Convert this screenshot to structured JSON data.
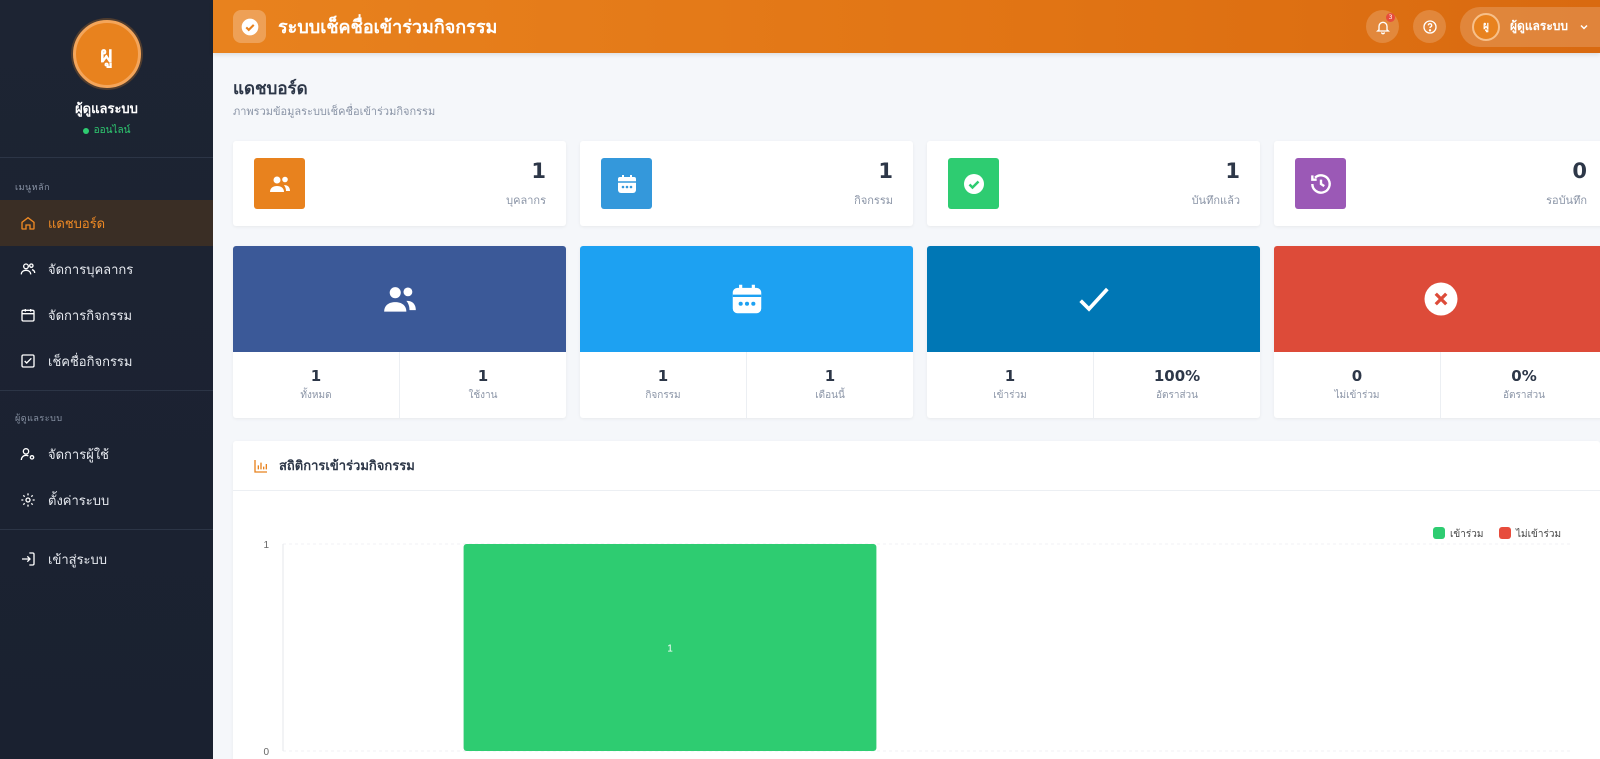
{
  "sidebar": {
    "avatar_initials": "ผู",
    "user_name": "ผู้ดูแลระบบ",
    "status": "ออนไลน์",
    "section_main": "เมนูหลัก",
    "section_admin": "ผู้ดูแลระบบ",
    "items": [
      {
        "label": "แดชบอร์ด",
        "icon": "home-icon",
        "active": true
      },
      {
        "label": "จัดการบุคลากร",
        "icon": "users-icon"
      },
      {
        "label": "จัดการกิจกรรม",
        "icon": "calendar-icon"
      },
      {
        "label": "เช็คชื่อกิจกรรม",
        "icon": "checkbox-icon"
      }
    ],
    "admin_items": [
      {
        "label": "จัดการผู้ใช้",
        "icon": "user-cog-icon"
      },
      {
        "label": "ตั้งค่าระบบ",
        "icon": "gear-icon"
      }
    ],
    "login_label": "เข้าสู่ระบบ"
  },
  "header": {
    "title": "ระบบเช็คชื่อเข้าร่วมกิจกรรม",
    "notification_count": "3",
    "user_initials": "ผู",
    "user_name": "ผู้ดูแลระบบ"
  },
  "page": {
    "title": "แดชบอร์ด",
    "subtitle": "ภาพรวมข้อมูลระบบเช็คชื่อเข้าร่วมกิจกรรม"
  },
  "stats": [
    {
      "value": "1",
      "label": "บุคลากร",
      "color": "#e8821e",
      "icon": "users-icon"
    },
    {
      "value": "1",
      "label": "กิจกรรม",
      "color": "#3498db",
      "icon": "calendar-icon"
    },
    {
      "value": "1",
      "label": "บันทึกแล้ว",
      "color": "#2ecc71",
      "icon": "check-circle-icon"
    },
    {
      "value": "0",
      "label": "รอบันทึก",
      "color": "#9b59b6",
      "icon": "history-icon"
    }
  ],
  "big_cards": [
    {
      "color": "#3b5998",
      "icon": "users-icon",
      "left_value": "1",
      "left_label": "ทั้งหมด",
      "right_value": "1",
      "right_label": "ใช้งาน"
    },
    {
      "color": "#1da1f2",
      "icon": "calendar-icon",
      "left_value": "1",
      "left_label": "กิจกรรม",
      "right_value": "1",
      "right_label": "เดือนนี้"
    },
    {
      "color": "#0077b5",
      "icon": "check-icon",
      "left_value": "1",
      "left_label": "เข้าร่วม",
      "right_value": "100%",
      "right_label": "อัตราส่วน"
    },
    {
      "color": "#dd4b39",
      "icon": "x-circle-icon",
      "left_value": "0",
      "left_label": "ไม่เข้าร่วม",
      "right_value": "0%",
      "right_label": "อัตราส่วน"
    }
  ],
  "chart_section": {
    "title": "สถิติการเข้าร่วมกิจกรรม"
  },
  "chart_data": {
    "type": "bar",
    "categories": [
      ""
    ],
    "series": [
      {
        "name": "เข้าร่วม",
        "values": [
          1
        ],
        "color": "#2ecc71"
      },
      {
        "name": "ไม่เข้าร่วม",
        "values": [
          0
        ],
        "color": "#e74c3c"
      }
    ],
    "ylim": [
      0,
      1
    ],
    "yticks": [
      "1",
      "0"
    ],
    "data_labels": [
      "1"
    ],
    "legend": "top-right"
  }
}
